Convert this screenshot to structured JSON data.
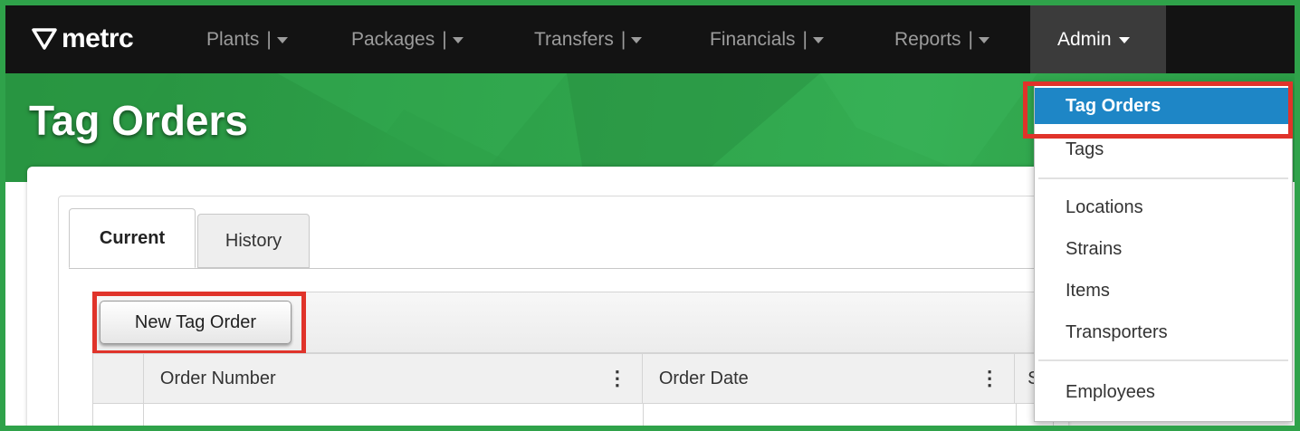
{
  "brand": {
    "name": "metrc"
  },
  "nav": {
    "items": [
      {
        "label": "Plants",
        "sep": "|"
      },
      {
        "label": "Packages",
        "sep": "|"
      },
      {
        "label": "Transfers",
        "sep": "|"
      },
      {
        "label": "Financials",
        "sep": "|"
      },
      {
        "label": "Reports",
        "sep": "|"
      }
    ],
    "admin_label": "Admin"
  },
  "page": {
    "title": "Tag Orders"
  },
  "tabs": [
    {
      "label": "Current",
      "active": true
    },
    {
      "label": "History",
      "active": false
    }
  ],
  "toolbar": {
    "new_tag_order_label": "New Tag Order"
  },
  "grid": {
    "columns": [
      "Order Number",
      "Order Date",
      "S"
    ]
  },
  "admin_menu": {
    "items": [
      "Tag Orders",
      "Tags",
      "Locations",
      "Strains",
      "Items",
      "Transporters",
      "Employees"
    ],
    "active": "Tag Orders"
  },
  "colors": {
    "frame_green": "#2fa24a",
    "highlight_red": "#e0332a",
    "menu_active_blue": "#1e86c6"
  }
}
